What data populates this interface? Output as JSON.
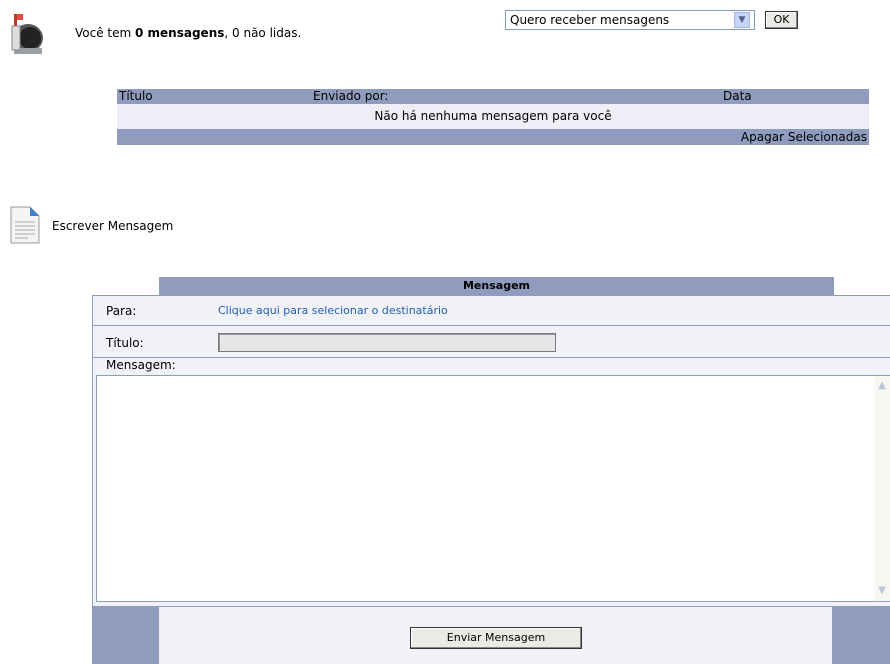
{
  "summary": {
    "prefix": "Você tem ",
    "count_bold": "0 mensagens",
    "suffix": ", 0 não lidas."
  },
  "receive_select": {
    "value": "Quero receber mensagens"
  },
  "ok_button": "OK",
  "table": {
    "headers": [
      "Título",
      "Enviado por:",
      "Data"
    ],
    "empty_message": "Não há nenhuma mensagem para você",
    "delete_selected": "Apagar Selecionadas"
  },
  "write": {
    "label": "Escrever Mensagem"
  },
  "form": {
    "header": "Mensagem",
    "para_label": "Para:",
    "para_link": "Clique aqui para selecionar o destinatário",
    "titulo_label": "Título:",
    "titulo_value": "",
    "mensagem_label": "Mensagem:",
    "mensagem_value": "",
    "send_button": "Enviar Mensagem"
  },
  "icons": {
    "mailbox": "mailbox-icon",
    "write": "document-icon",
    "dropdown": "chevron-down-icon"
  }
}
